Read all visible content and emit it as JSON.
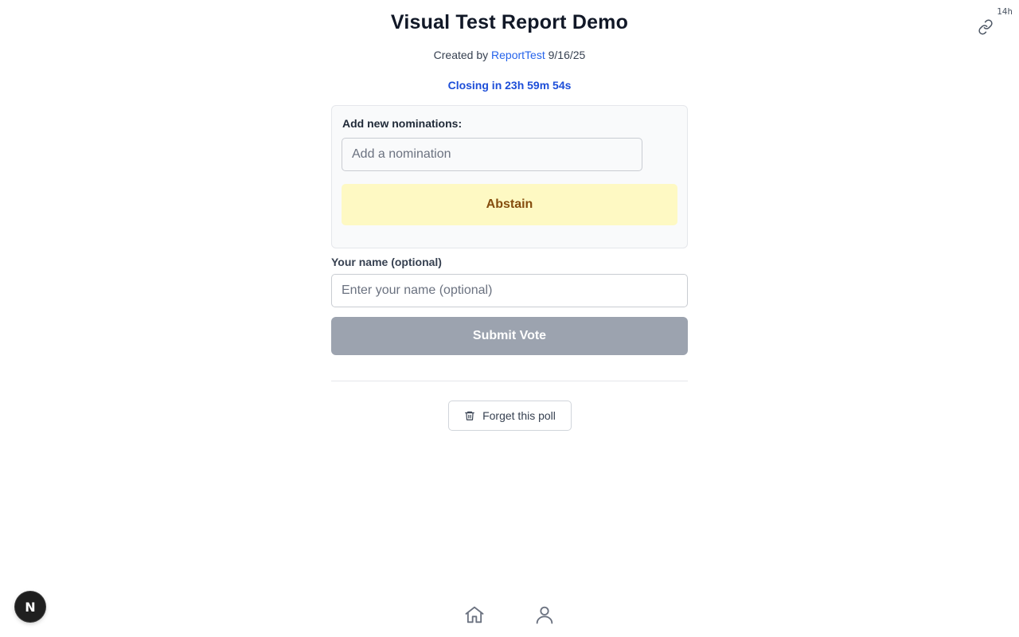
{
  "corner": {
    "time_ago": "14h",
    "link_icon": "link-icon"
  },
  "poll": {
    "title": "Visual Test Report Demo",
    "created_by_prefix": "Created by",
    "author": "ReportTest",
    "date": "9/16/25",
    "countdown": "Closing in 23h 59m 54s"
  },
  "nominations": {
    "label": "Add new nominations:",
    "input_placeholder": "Add a nomination",
    "input_value": "",
    "abstain_label": "Abstain"
  },
  "voter": {
    "label": "Your name (optional)",
    "input_placeholder": "Enter your name (optional)",
    "input_value": ""
  },
  "actions": {
    "submit_label": "Submit Vote",
    "forget_label": "Forget this poll",
    "forget_icon": "trash-icon"
  },
  "dev_badge": {
    "letter": "N"
  },
  "bottom_nav": {
    "home_icon": "home-icon",
    "user_icon": "user-icon"
  },
  "colors": {
    "accent_link": "#2563eb",
    "countdown": "#1d4ed8",
    "abstain_bg": "#fef9c3",
    "abstain_text": "#854d0e",
    "submit_disabled_bg": "#9ca3af"
  }
}
